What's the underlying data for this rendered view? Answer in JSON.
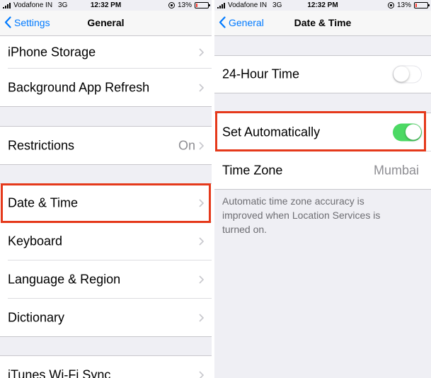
{
  "colors": {
    "accent": "#007aff",
    "toggle_on": "#4cd964",
    "highlight": "#e5391b",
    "battery_low": "#ff3b30"
  },
  "left": {
    "status": {
      "carrier": "Vodafone IN",
      "network": "3G",
      "time": "12:32 PM",
      "battery": "13%",
      "battery_level": 0.13
    },
    "nav": {
      "back_label": "Settings",
      "title": "General"
    },
    "rows": {
      "iphone_storage": "iPhone Storage",
      "background_refresh": "Background App Refresh",
      "restrictions": "Restrictions",
      "restrictions_value": "On",
      "date_time": "Date & Time",
      "keyboard": "Keyboard",
      "language_region": "Language & Region",
      "dictionary": "Dictionary",
      "itunes_sync": "iTunes Wi-Fi Sync"
    }
  },
  "right": {
    "status": {
      "carrier": "Vodafone IN",
      "network": "3G",
      "time": "12:32 PM",
      "battery": "13%",
      "battery_level": 0.13
    },
    "nav": {
      "back_label": "General",
      "title": "Date & Time"
    },
    "rows": {
      "hour24": "24-Hour Time",
      "hour24_on": false,
      "set_auto": "Set Automatically",
      "set_auto_on": true,
      "time_zone": "Time Zone",
      "time_zone_value": "Mumbai"
    },
    "footnote": "Automatic time zone accuracy is improved when Location Services is turned on."
  }
}
